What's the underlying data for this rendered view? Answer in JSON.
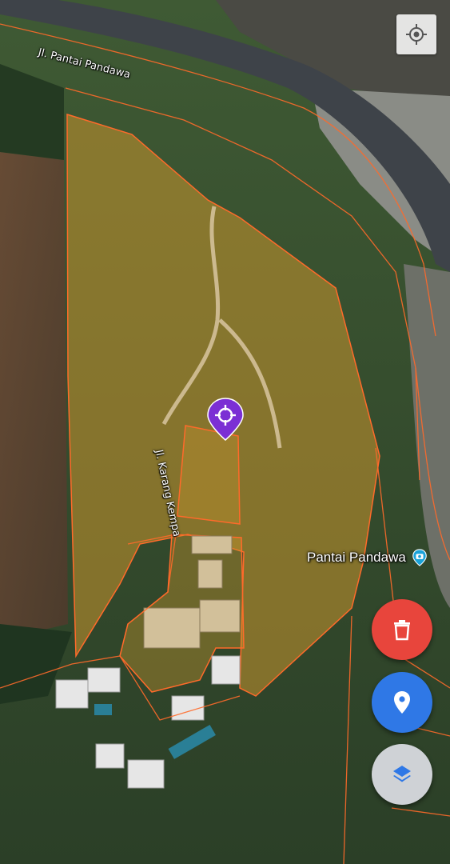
{
  "map": {
    "roads": {
      "main_road": "Jl. Pantai Pandawa",
      "side_road": "Jl. Karang Kempa"
    },
    "poi": {
      "name": "Pantai Pandawa",
      "icon": "camera-pin-icon",
      "color": "#1aa3d9"
    },
    "selected_marker": {
      "icon": "crosshair-pin-icon",
      "color": "#7b2fd4"
    },
    "parcel_outline_color": "#ff6a2a",
    "parcel_fill_color": "#d9a441"
  },
  "controls": {
    "my_location": {
      "icon": "crosshair-icon"
    },
    "delete": {
      "icon": "trash-icon",
      "color": "#e8453c"
    },
    "place": {
      "icon": "location-pin-icon",
      "color": "#2f78e6"
    },
    "layers": {
      "icon": "layers-icon",
      "color": "#cfd2d6"
    }
  }
}
